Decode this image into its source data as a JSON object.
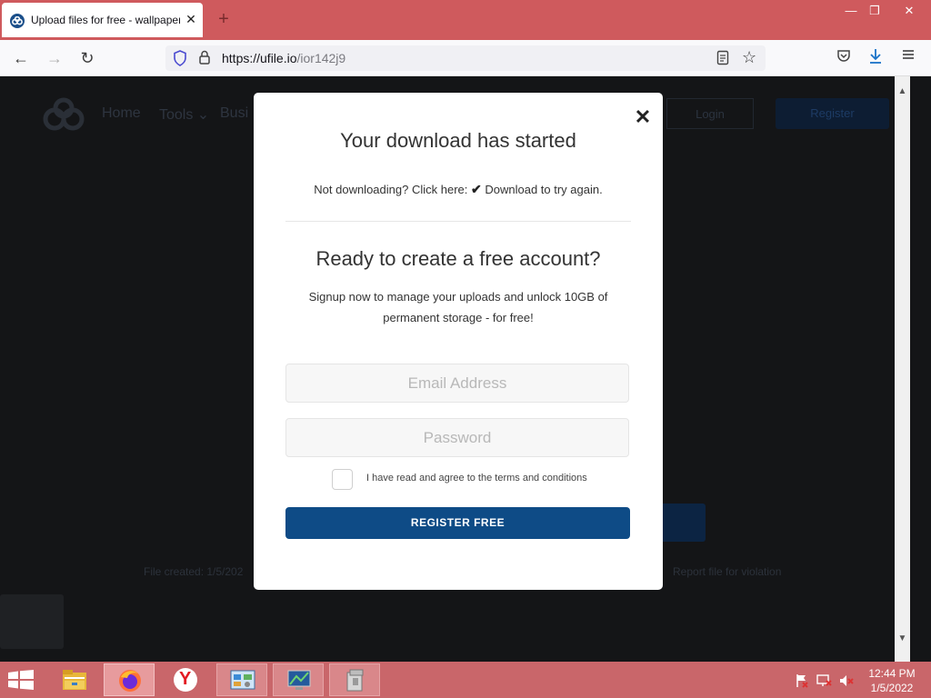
{
  "browser": {
    "tab_title": "Upload files for free - wallpaper",
    "tab_close": "✕",
    "new_tab": "+",
    "window_controls": {
      "minimize": "—",
      "restore": "❐",
      "close": "✕"
    },
    "nav": {
      "back": "←",
      "forward": "→",
      "reload": "↻"
    },
    "url_host": "https://ufile.io",
    "url_path": "/ior142j9",
    "bookmark_star": "☆",
    "icons": [
      "shield-icon",
      "lock-icon",
      "reader-view-icon",
      "star-icon",
      "pocket-icon",
      "download-icon",
      "menu-icon"
    ]
  },
  "page_background": {
    "nav": {
      "home": "Home",
      "tools": "Tools ⌄",
      "business": "Busi"
    },
    "login": "Login",
    "register": "Register",
    "file_created": "File created: 1/5/202",
    "report": "Report file for violation"
  },
  "modal": {
    "close": "✕",
    "title": "Your download has started",
    "not_downloading": "Not downloading? Click here:",
    "check": "✔",
    "retry_link": "Download to try again.",
    "account_title": "Ready to create a free account?",
    "description": "Signup now to manage your uploads and unlock 10GB of permanent storage - for free!",
    "email_placeholder": "Email Address",
    "password_placeholder": "Password",
    "agree_label": "I have read and agree to the terms and conditions",
    "register_button": "REGISTER FREE",
    "brand_color": "#0e4b86"
  },
  "scrollbar": {
    "up": "▲",
    "down": "▼"
  },
  "taskbar": {
    "items": [
      "file-explorer",
      "firefox",
      "yandex",
      "control-panel",
      "network",
      "archive"
    ],
    "time": "12:44 PM",
    "date": "1/5/2022",
    "yandex_letter": "Y"
  }
}
